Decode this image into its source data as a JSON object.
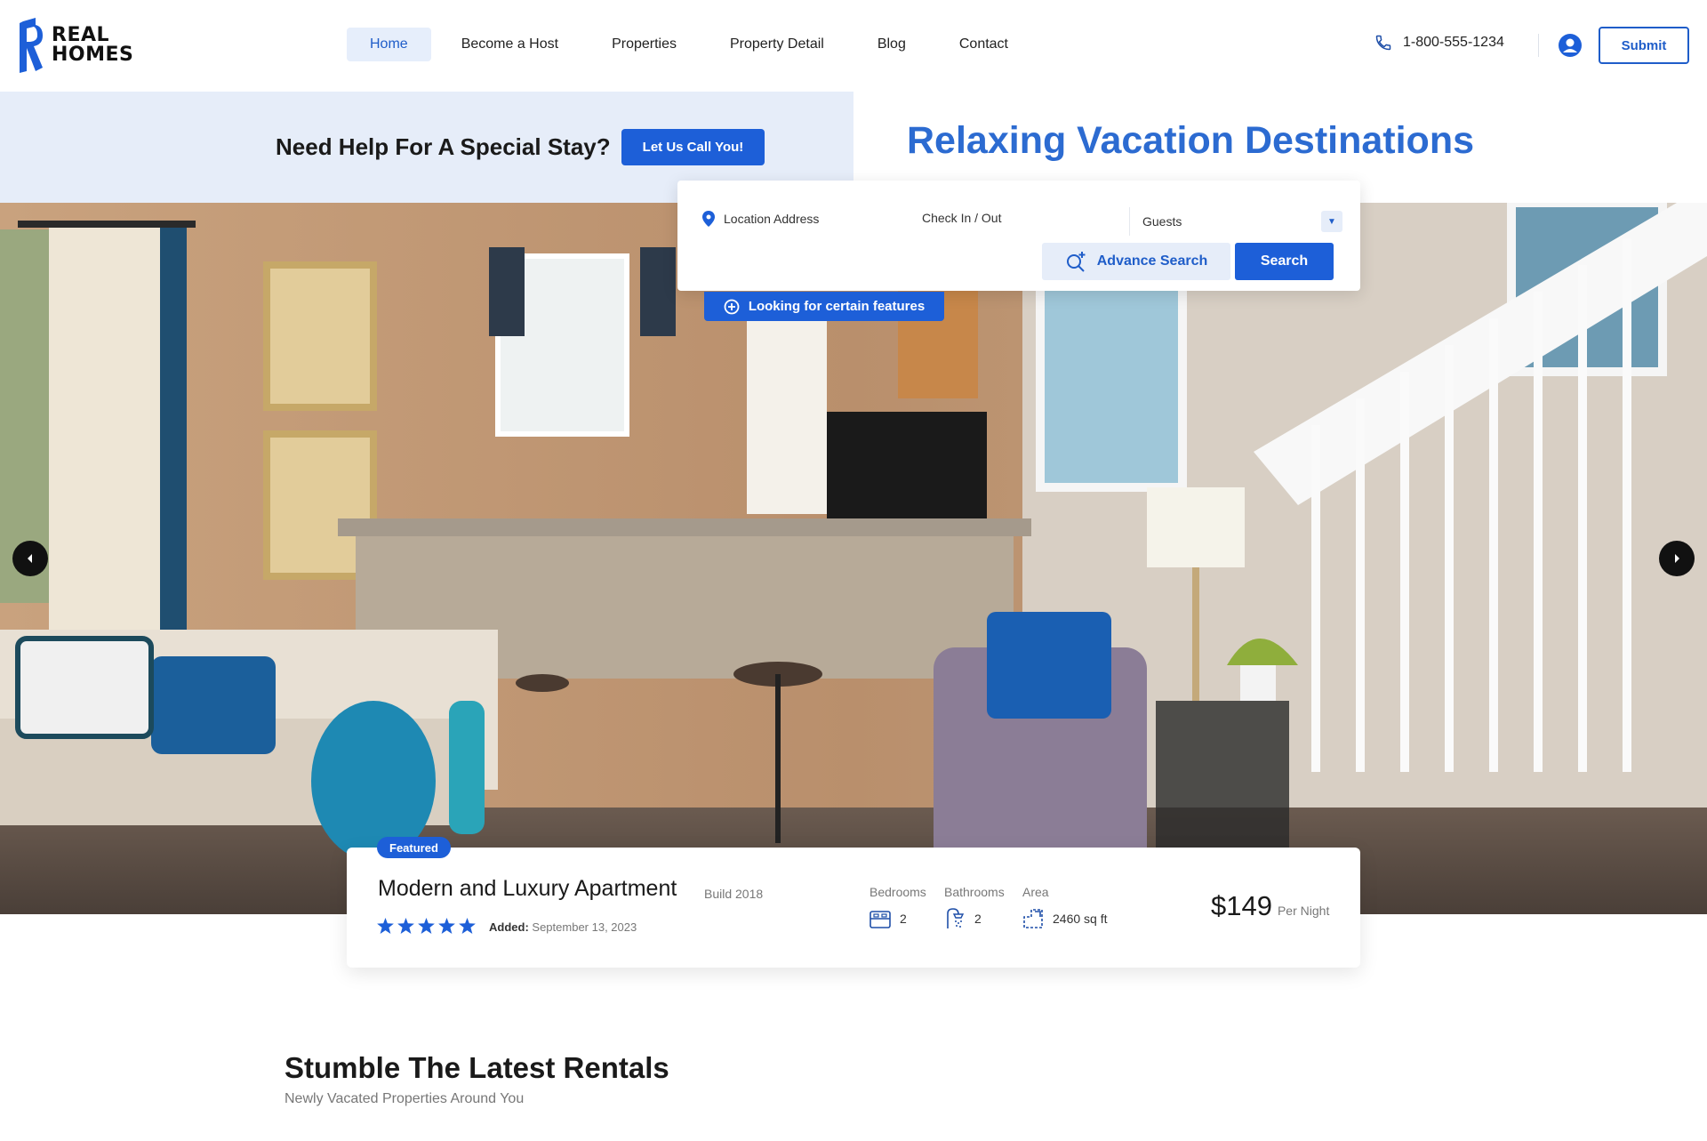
{
  "logo": {
    "line1": "REAL",
    "line2": "HOMES"
  },
  "nav": {
    "items": [
      {
        "label": "Home"
      },
      {
        "label": "Become a Host"
      },
      {
        "label": "Properties"
      },
      {
        "label": "Property Detail"
      },
      {
        "label": "Blog"
      },
      {
        "label": "Contact"
      }
    ],
    "active_index": 0
  },
  "header": {
    "phone": "1-800-555-1234",
    "submit_label": "Submit"
  },
  "help": {
    "text": "Need Help For A Special Stay?",
    "button_label": "Let Us Call You!"
  },
  "hero": {
    "title": "Relaxing Vacation Destinations"
  },
  "search": {
    "location_placeholder": "Location Address",
    "checkin_placeholder": "Check In / Out",
    "guests_label": "Guests",
    "advance_label": "Advance Search",
    "search_label": "Search",
    "features_label": "Looking for certain features"
  },
  "property": {
    "badge": "Featured",
    "title": "Modern and Luxury Apartment",
    "build": "Build 2018",
    "rating": 5,
    "added_label": "Added:",
    "added_date": "September 13, 2023",
    "bedrooms_label": "Bedrooms",
    "bedrooms": "2",
    "bathrooms_label": "Bathrooms",
    "bathrooms": "2",
    "area_label": "Area",
    "area": "2460 sq ft",
    "price": "$149",
    "price_unit": "Per Night"
  },
  "section": {
    "title": "Stumble The Latest Rentals",
    "subtitle": "Newly Vacated Properties Around You"
  },
  "colors": {
    "accent": "#1d5fd8",
    "title_blue": "#2c6bd1",
    "light_band": "#e6edf9"
  }
}
